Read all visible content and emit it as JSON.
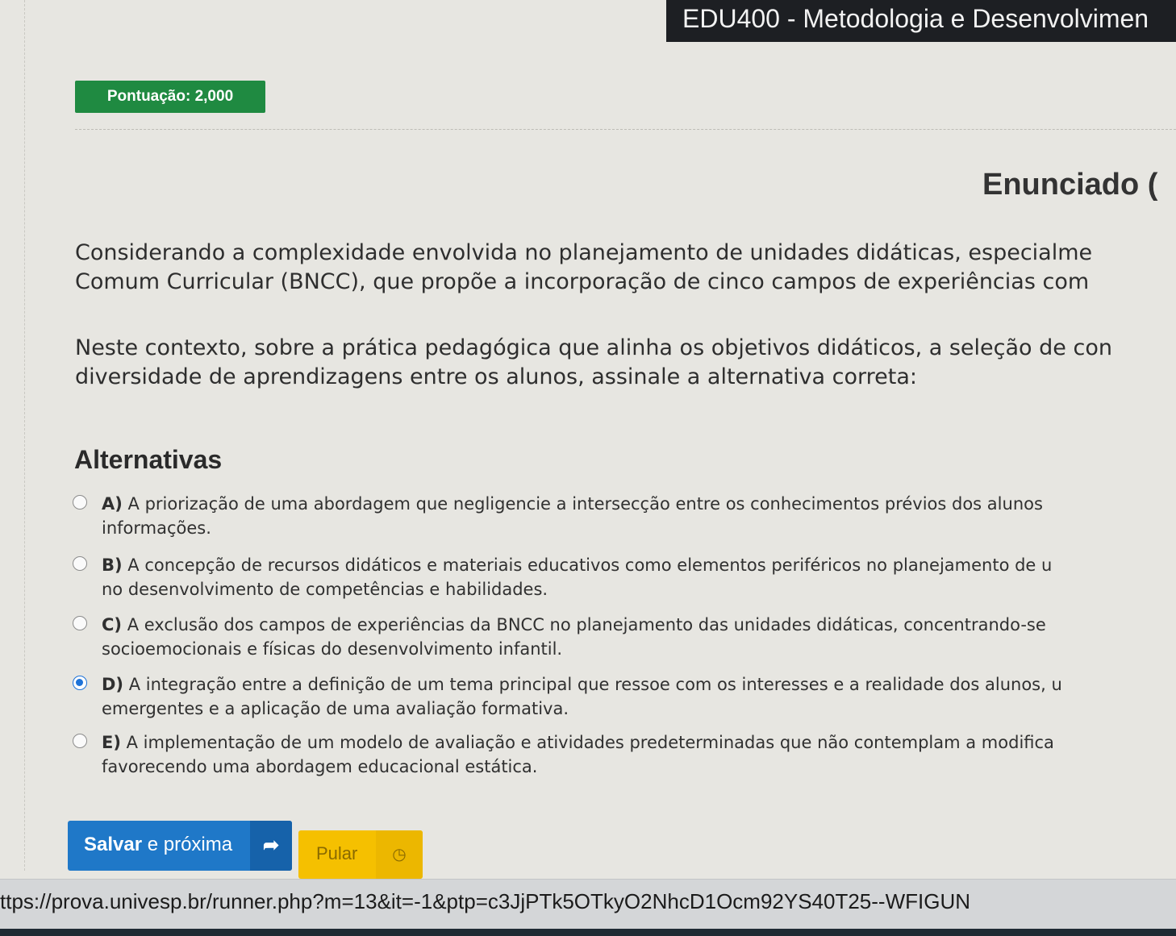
{
  "header": {
    "course_title": "EDU400 - Metodologia e Desenvolvimen"
  },
  "score": {
    "label": "Pontuação: 2,000"
  },
  "section": {
    "title": "Enunciado ("
  },
  "statement": {
    "paragraph1": [
      "Considerando a complexidade envolvida no planejamento de unidades didáticas, especialme",
      "Comum Curricular (BNCC), que propõe a incorporação de cinco campos de experiências com"
    ],
    "paragraph2": [
      "Neste contexto, sobre a prática pedagógica que alinha os objetivos didáticos, a seleção de con",
      "diversidade de aprendizagens entre os alunos, assinale a alternativa correta:"
    ]
  },
  "alternatives": {
    "heading": "Alternativas",
    "selected": "D",
    "items": [
      {
        "letter": "A)",
        "line1": " A priorização de uma abordagem que negligencie a intersecção entre os conhecimentos prévios dos alunos",
        "line2": "informações."
      },
      {
        "letter": "B)",
        "line1": " A concepção de recursos didáticos e materiais educativos como elementos periféricos no planejamento de u",
        "line2": "no desenvolvimento de competências e habilidades."
      },
      {
        "letter": "C)",
        "line1": " A exclusão dos campos de experiências da BNCC no planejamento das unidades didáticas, concentrando-se",
        "line2": "socioemocionais e físicas do desenvolvimento infantil."
      },
      {
        "letter": "D)",
        "line1": " A integração entre a definição de um tema principal que ressoe com os interesses e a realidade dos alunos, u",
        "line2": "emergentes e a aplicação de uma avaliação formativa."
      },
      {
        "letter": "E)",
        "line1": " A implementação de um modelo de avaliação e atividades predeterminadas que não contemplam a modifica",
        "line2": "favorecendo uma abordagem educacional estática."
      }
    ]
  },
  "actions": {
    "save_bold": "Salvar",
    "save_rest": " e próxima",
    "save_icon": "arrow-right-icon",
    "skip_label": "Pular",
    "skip_icon": "clock-icon"
  },
  "status_bar": {
    "url": "ttps://prova.univesp.br/runner.php?m=13&it=-1&ptp=c3JjPTk5OTkyO2NhcD1Ocm92YS40T25--WFIGUN"
  },
  "colors": {
    "score_badge": "#1f8a41",
    "save_button": "#1f78c8",
    "skip_button": "#f5c000",
    "header_bg": "#1d1f23",
    "radio_selected": "#1e73d8"
  }
}
